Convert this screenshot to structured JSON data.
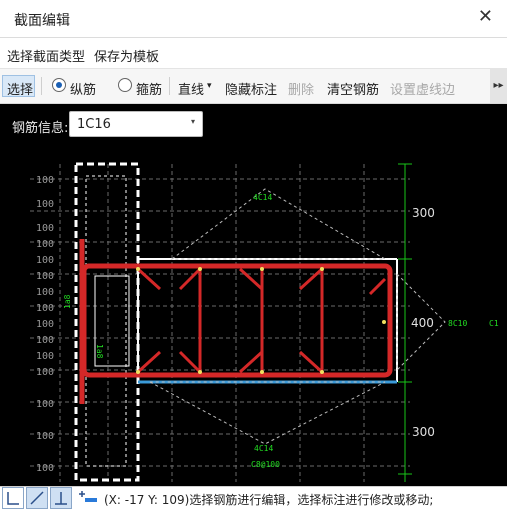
{
  "window": {
    "title": "截面编辑",
    "close_glyph": "✕"
  },
  "menu": {
    "items": [
      "选择截面类型",
      "保存为模板"
    ]
  },
  "toolbar": {
    "select": "选择",
    "radio_longitudinal": "纵筋",
    "radio_stirrup": "箍筋",
    "line": "直线",
    "line_dropdown_glyph": "▾",
    "hide_annotation": "隐藏标注",
    "delete": "删除",
    "clear_rebar": "清空钢筋",
    "set_dashed_edge": "设置虚线边",
    "more_glyph": "▸▸"
  },
  "rebar_info": {
    "label": "钢筋信息:",
    "value": "1C16",
    "dropdown_glyph": "▾"
  },
  "drawing": {
    "grid_labels": [
      "100",
      "100",
      "100",
      "100",
      "100",
      "100",
      "100",
      "100",
      "100",
      "100",
      "100",
      "100",
      "100",
      "100",
      "100"
    ],
    "dimensions": [
      "300",
      "400",
      "300"
    ],
    "annotations": {
      "top": "4C14",
      "bottom": "4C14",
      "stirrup": "C8@100",
      "right": "8C10",
      "right_far": "C1",
      "vertical_1": "1a8",
      "vertical_2": "1a8"
    },
    "colors": {
      "rebar": "#d42828",
      "outline": "#ffffff",
      "dimension": "#19c419",
      "annotation": "#22dd22",
      "blue_edge": "#3a9ad9",
      "grid": "#7a7a7a"
    }
  },
  "status": {
    "text": "(X: -17 Y: 109)选择钢筋进行编辑，选择标注进行修改或移动;"
  }
}
